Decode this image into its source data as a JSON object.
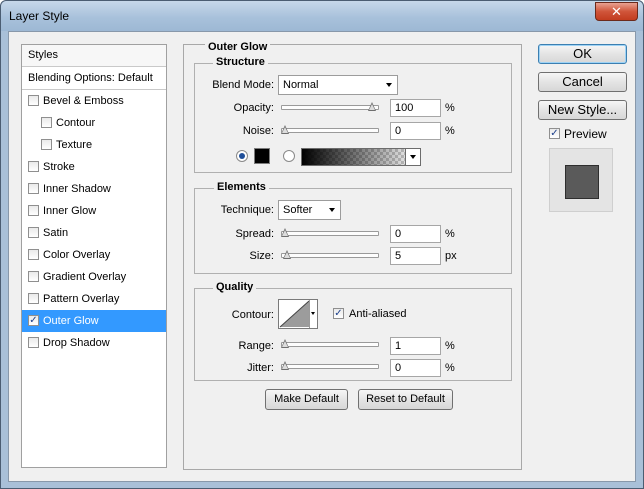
{
  "window": {
    "title": "Layer Style",
    "close_glyph": "✕"
  },
  "styles_panel": {
    "header": "Styles",
    "blending": "Blending Options: Default",
    "items": [
      {
        "label": "Bevel & Emboss",
        "checked": false
      },
      {
        "label": "Contour",
        "checked": false
      },
      {
        "label": "Texture",
        "checked": false
      },
      {
        "label": "Stroke",
        "checked": false
      },
      {
        "label": "Inner Shadow",
        "checked": false
      },
      {
        "label": "Inner Glow",
        "checked": false
      },
      {
        "label": "Satin",
        "checked": false
      },
      {
        "label": "Color Overlay",
        "checked": false
      },
      {
        "label": "Gradient Overlay",
        "checked": false
      },
      {
        "label": "Pattern Overlay",
        "checked": false
      },
      {
        "label": "Outer Glow",
        "checked": true
      },
      {
        "label": "Drop Shadow",
        "checked": false
      }
    ],
    "check_mark": "✓"
  },
  "main": {
    "section_title": "Outer Glow",
    "structure": {
      "title": "Structure",
      "blend_mode_label": "Blend Mode:",
      "blend_mode_value": "Normal",
      "opacity_label": "Opacity:",
      "opacity_value": "100",
      "opacity_level": 1.0,
      "opacity_unit": "%",
      "noise_label": "Noise:",
      "noise_value": "0",
      "noise_level": 0.0,
      "noise_unit": "%",
      "color_radio_selected": true,
      "gradient_radio_selected": false
    },
    "elements": {
      "title": "Elements",
      "technique_label": "Technique:",
      "technique_value": "Softer",
      "spread_label": "Spread:",
      "spread_value": "0",
      "spread_level": 0.0,
      "spread_unit": "%",
      "size_label": "Size:",
      "size_value": "5",
      "size_level": 0.02,
      "size_unit": "px"
    },
    "quality": {
      "title": "Quality",
      "contour_label": "Contour:",
      "anti_aliased_label": "Anti-aliased",
      "anti_aliased_checked": true,
      "range_label": "Range:",
      "range_value": "1",
      "range_level": 0.0,
      "range_unit": "%",
      "jitter_label": "Jitter:",
      "jitter_value": "0",
      "jitter_level": 0.0,
      "jitter_unit": "%"
    },
    "make_default": "Make Default",
    "reset_default": "Reset to Default"
  },
  "right": {
    "ok": "OK",
    "cancel": "Cancel",
    "new_style": "New Style...",
    "preview_label": "Preview",
    "preview_checked": true
  },
  "colors": {
    "selected": "#3399ff",
    "glow_color": "#000000"
  }
}
